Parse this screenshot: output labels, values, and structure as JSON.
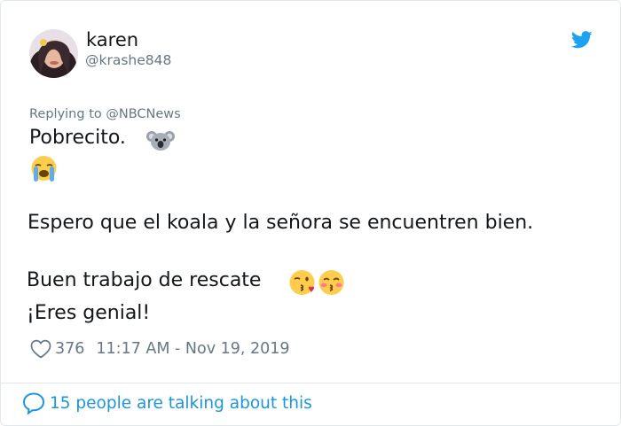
{
  "tweet": {
    "author_name": "karen",
    "author_handle": "@krashe848",
    "reply_prefix": "Replying to ",
    "reply_to": "@NBCNews",
    "line1": "Pobrecito.",
    "line3": "Espero que el koala y la señora se encuentren bien.",
    "line4": "Buen trabajo de rescate",
    "line5": "¡Eres genial!",
    "emojis": [
      "koala-emoji",
      "crying-face-emoji",
      "kissing-face-winking-emoji",
      "kissing-face-blushing-emoji"
    ],
    "like_count": "376",
    "timestamp": "11:17 AM - Nov 19, 2019",
    "conversation_text": "15 people are talking about this"
  },
  "colors": {
    "text": "#14171a",
    "secondary": "#657786",
    "accent": "#1b95e0",
    "twitter_blue": "#1da1f2",
    "border": "#e1e8ed"
  },
  "icons": {
    "logo": "twitter-bird-icon",
    "like": "heart-icon",
    "conversation": "speech-bubble-icon"
  }
}
